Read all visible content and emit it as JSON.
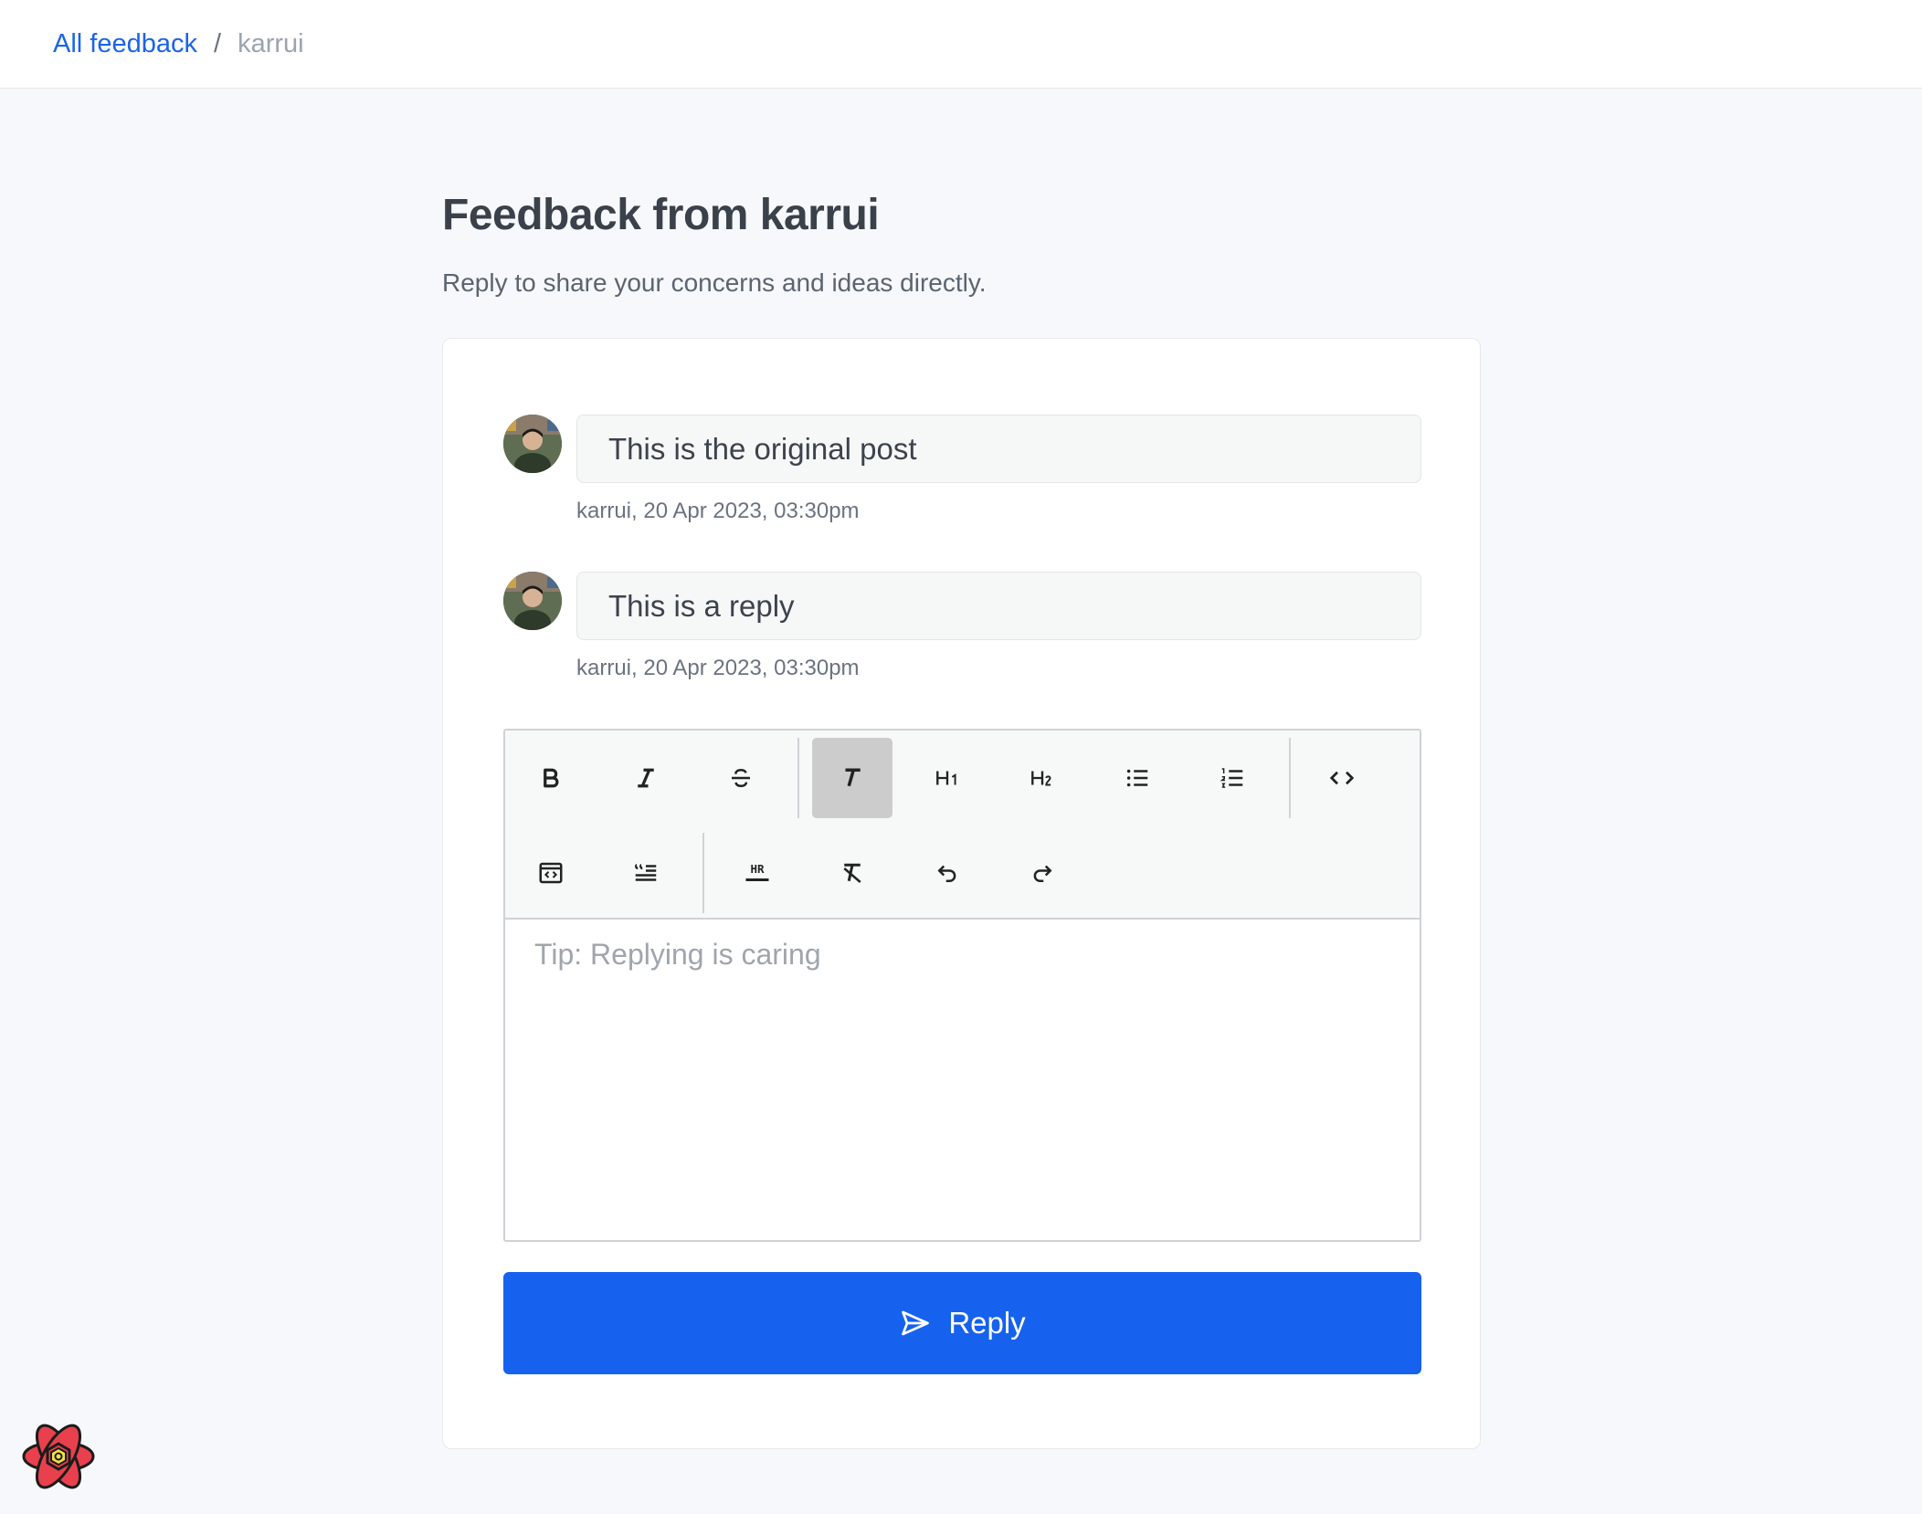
{
  "breadcrumb": {
    "link_label": "All feedback",
    "separator": "/",
    "current": "karrui"
  },
  "header": {
    "title": "Feedback from karrui",
    "subtitle": "Reply to share your concerns and ideas directly."
  },
  "messages": [
    {
      "text": "This is the original post",
      "meta": "karrui, 20 Apr 2023, 03:30pm"
    },
    {
      "text": "This is a reply",
      "meta": "karrui, 20 Apr 2023, 03:30pm"
    }
  ],
  "editor": {
    "placeholder": "Tip: Replying is caring",
    "toolbar_icons": [
      "bold-icon",
      "italic-icon",
      "strikethrough-icon",
      "text-icon",
      "heading-1-icon",
      "heading-2-icon",
      "bullet-list-icon",
      "ordered-list-icon",
      "code-icon",
      "code-block-icon",
      "blockquote-icon",
      "horizontal-rule-icon",
      "clear-format-icon",
      "undo-icon",
      "redo-icon"
    ],
    "active_tool": "text-icon"
  },
  "reply_button": {
    "label": "Reply",
    "icon": "send-icon"
  },
  "colors": {
    "accent": "#1662ee",
    "link": "#1a64e8",
    "background": "#f7f8fb"
  }
}
